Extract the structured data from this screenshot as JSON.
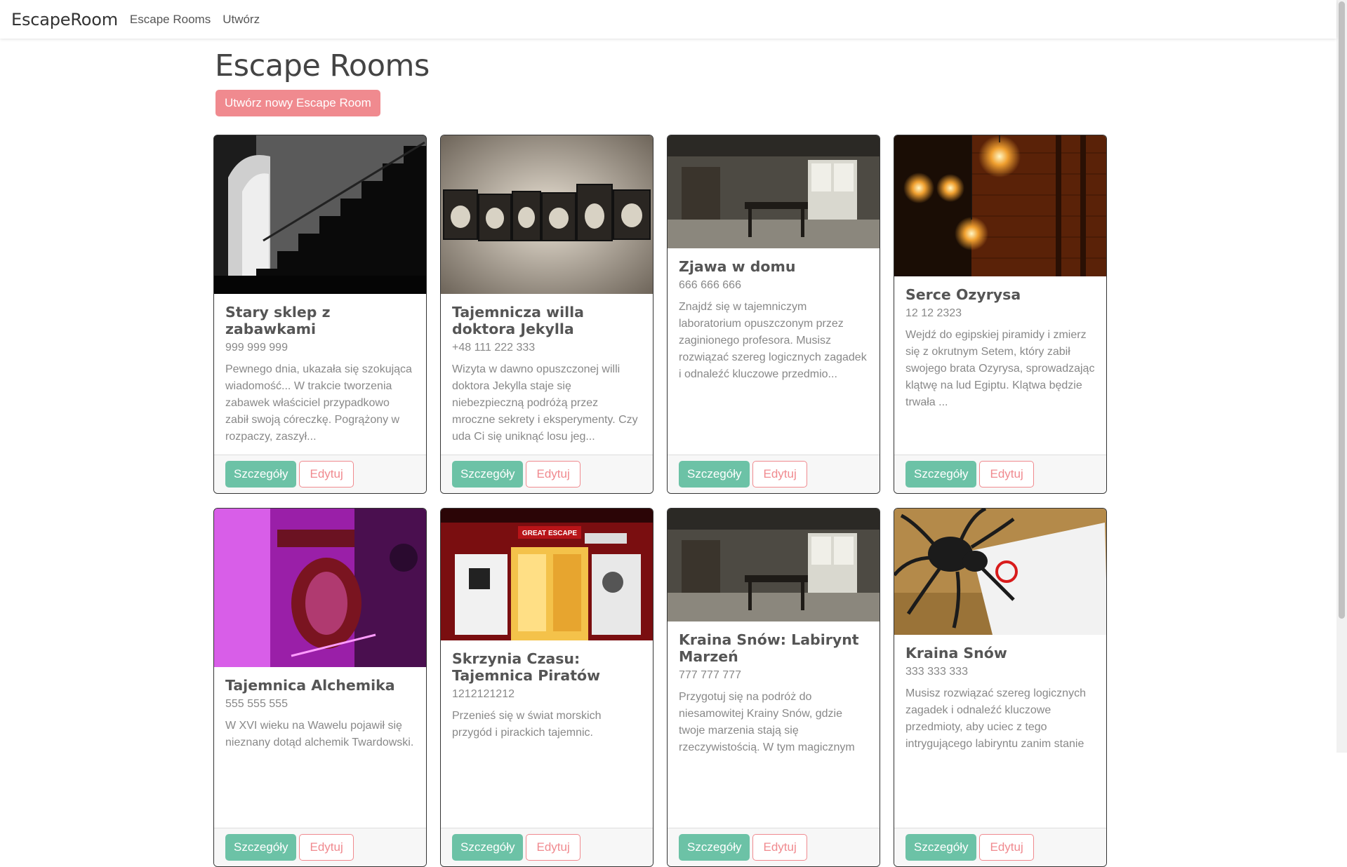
{
  "navbar": {
    "brand": "EscapeRoom",
    "links": [
      "Escape Rooms",
      "Utwórz"
    ]
  },
  "page": {
    "title": "Escape Rooms",
    "create_button": "Utwórz nowy Escape Room"
  },
  "buttons": {
    "details": "Szczegóły",
    "edit": "Edytuj"
  },
  "colors": {
    "primary": "#f08a8f",
    "success": "#6cc2a6"
  },
  "cards": [
    {
      "title": "Stary sklep z zabawkami",
      "phone": "999 999 999",
      "description": "Pewnego dnia, ukazała się szokująca wiadomość... W trakcie tworzenia zabawek właściciel przypadkowo zabił swoją córeczkę. Pogrążony w rozpaczy, zaszył...",
      "image": "dark-staircase-image"
    },
    {
      "title": "Tajemnicza willa doktora Jekylla",
      "phone": "+48 111 222 333",
      "description": "Wizyta w dawno opuszczonej willi doktora Jekylla staje się niebezpieczną podróżą przez mroczne sekrety i eksperymenty. Czy uda Ci się uniknąć losu jeg...",
      "image": "escape-letterpress-image"
    },
    {
      "title": "Zjawa w domu",
      "phone": "666 666 666",
      "description": "Znajdź się w tajemniczym laboratorium opuszczonym przez zaginionego profesora. Musisz rozwiązać szereg logicznych zagadek i odnaleźć kluczowe przedmio...",
      "image": "abandoned-room-image"
    },
    {
      "title": "Serce Ozyrysa",
      "phone": "12 12 2323",
      "description": "Wejdź do egipskiej piramidy i zmierz się z okrutnym Setem, który zabił swojego brata Ozyrysa, sprowadzając klątwę na lud Egiptu. Klątwa będzie trwała ...",
      "image": "brick-wall-lamps-image"
    },
    {
      "title": "Tajemnica Alchemika",
      "phone": "555 555 555",
      "description": "W XVI wieku na Wawelu pojawił się nieznany dotąd alchemik Twardowski.",
      "image": "purple-room-image"
    },
    {
      "title": "Skrzynia Czasu: Tajemnica Piratów",
      "phone": "1212121212",
      "description": "Przenieś się w świat morskich przygód i pirackich tajemnic.",
      "image": "great-escape-storefront-image",
      "sign": "GREAT ESCAPE"
    },
    {
      "title": "Kraina Snów: Labirynt Marzeń",
      "phone": "777 777 777",
      "description": "Przygotuj się na podróż do niesamowitej Krainy Snów, gdzie twoje marzenia stają się rzeczywistością. W tym magicznym",
      "image": "abandoned-room-image"
    },
    {
      "title": "Kraina Snów",
      "phone": "333 333 333",
      "description": "Musisz rozwiązać szereg logicznych zagadek i odnaleźć kluczowe przedmioty, aby uciec z tego intrygującego labiryntu zanim stanie",
      "image": "spider-room-escape-image"
    }
  ]
}
